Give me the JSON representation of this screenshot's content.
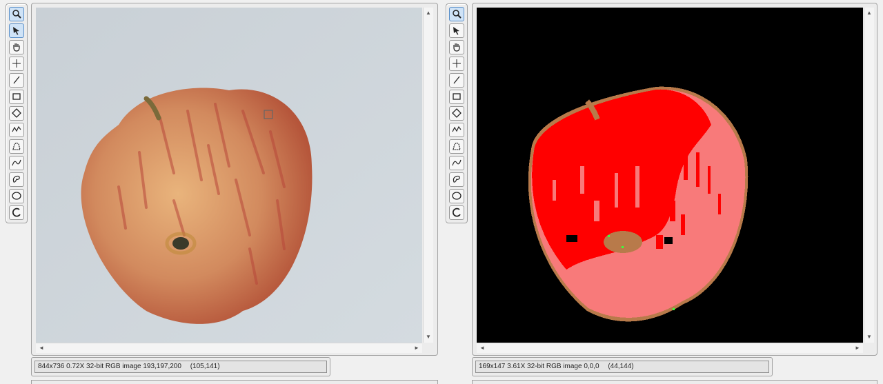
{
  "tools": [
    {
      "name": "zoom-tool",
      "icon": "magnifier-icon"
    },
    {
      "name": "select-tool",
      "icon": "arrow-icon"
    },
    {
      "name": "pan-tool",
      "icon": "hand-icon"
    },
    {
      "name": "point-tool",
      "icon": "crosshair-icon"
    },
    {
      "name": "line-tool",
      "icon": "line-icon"
    },
    {
      "name": "rectangle-tool",
      "icon": "rectangle-icon"
    },
    {
      "name": "rotated-rect-tool",
      "icon": "diamond-icon"
    },
    {
      "name": "polyline-tool",
      "icon": "polyline-icon"
    },
    {
      "name": "polygon-tool",
      "icon": "polygon-icon"
    },
    {
      "name": "spline-tool",
      "icon": "curve-icon"
    },
    {
      "name": "closed-spline-tool",
      "icon": "closed-curve-icon"
    },
    {
      "name": "ellipse-tool",
      "icon": "ellipse-icon"
    },
    {
      "name": "circle-arc-tool",
      "icon": "arc-icon"
    }
  ],
  "left": {
    "status": {
      "info": "844x736 0.72X 32-bit RGB image 193,197,200",
      "coords": "(105,141)"
    }
  },
  "right": {
    "status": {
      "info": "169x147 3.61X 32-bit RGB image 0,0,0",
      "coords": "(44,144)"
    }
  },
  "scroll": {
    "up": "▲",
    "down": "▼",
    "left": "◄",
    "right": "►"
  },
  "colors": {
    "panel_bg": "#ececec",
    "active_tool": "#cfe3f7",
    "seg_black": "#000000",
    "seg_red": "#ff0000",
    "seg_pink": "#f87a7a",
    "seg_brown": "#b87a4a"
  }
}
